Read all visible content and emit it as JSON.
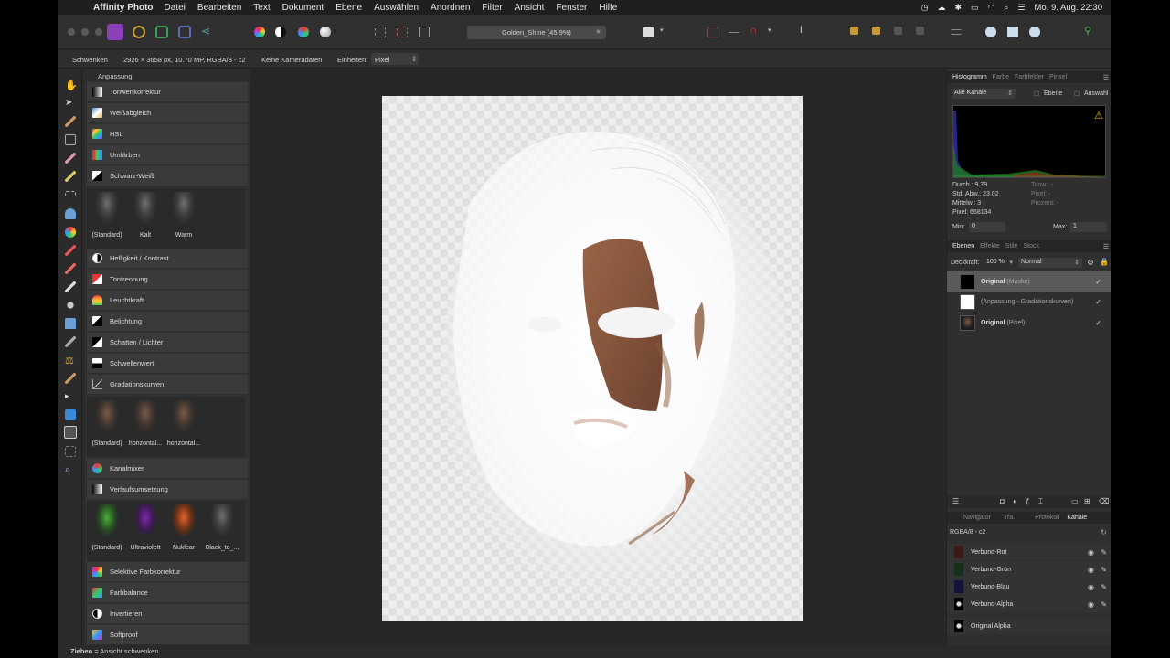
{
  "menubar": {
    "app_name": "Affinity Photo",
    "items": [
      "Datei",
      "Bearbeiten",
      "Text",
      "Dokument",
      "Ebene",
      "Auswählen",
      "Anordnen",
      "Filter",
      "Ansicht",
      "Fenster",
      "Hilfe"
    ],
    "clock": "Mo. 9. Aug.  22:30"
  },
  "toolbar": {
    "document_tab": "Golden_Shine (45.9%)"
  },
  "context_bar": {
    "tool": "Schwenken",
    "image_info": "2926 × 3658 px, 10.70 MP, RGBA/8 - c2",
    "camera": "Keine Kameradaten",
    "units_label": "Einheiten:",
    "units_value": "Pixel"
  },
  "adjustments": {
    "title": "Anpassung",
    "items": [
      "Tonwertkorrektur",
      "Weißabgleich",
      "HSL",
      "Umfärben",
      "Schwarz-Weiß",
      "Helligkeit / Kontrast",
      "Tontrennung",
      "Leuchtkraft",
      "Belichtung",
      "Schatten / Lichter",
      "Schwellenwert",
      "Gradationskurven",
      "Kanalmixer",
      "Verlaufsumsetzung",
      "Selektive Farbkorrektur",
      "Farbbalance",
      "Invertieren",
      "Softproof"
    ],
    "bw_presets": [
      "(Standard)",
      "Kalt",
      "Warm"
    ],
    "curves_presets": [
      "(Standard)",
      "horizontal...",
      "horizontal..."
    ],
    "gradient_presets": [
      "(Standard)",
      "Ultraviolett",
      "Nuklear",
      "Black_to_..."
    ]
  },
  "histogram": {
    "tabs": [
      "Histogramm",
      "Farbe",
      "Farbfelder",
      "Pinsel"
    ],
    "channel_select": "Alle Kanäle",
    "opt_layer": "Ebene",
    "opt_selection": "Auswahl",
    "stats_left": [
      "Durch.: 9.79",
      "Std. Abw.: 23.02",
      "Mittelw.: 3",
      "Pixel: 668134"
    ],
    "stats_right": [
      "Tonw.: -",
      "Pixel: -",
      "Prozent: -"
    ],
    "min_label": "Min:",
    "min_value": "0",
    "max_label": "Max:",
    "max_value": "1"
  },
  "layers": {
    "tabs": [
      "Ebenen",
      "Effekte",
      "Stile",
      "Stock"
    ],
    "opacity_label": "Deckkraft:",
    "opacity_value": "100 %",
    "blend_mode": "Normal",
    "rows": [
      {
        "name": "Original",
        "suffix": "(Maske)",
        "checked": "✓"
      },
      {
        "name": "",
        "suffix": "(Anpassung - Gradationskurven)",
        "checked": "✓"
      },
      {
        "name": "Original",
        "suffix": "(Pixel)",
        "checked": "✓"
      }
    ]
  },
  "channels": {
    "tabs": [
      "Navigator",
      "Tra.",
      "Protokoll",
      "Kanäle"
    ],
    "format": "RGBA/8 - c2",
    "rows": [
      "Verbund-Rot",
      "Verbund-Grün",
      "Verbund-Blau",
      "Verbund-Alpha"
    ],
    "extra_row": "Original Alpha"
  },
  "status": {
    "bold": "Ziehen",
    "text": " = Ansicht schwenken."
  },
  "colors": {
    "accent": "#8b3fb8",
    "bg_panel": "#313131",
    "skin": "#8a5a3c"
  }
}
